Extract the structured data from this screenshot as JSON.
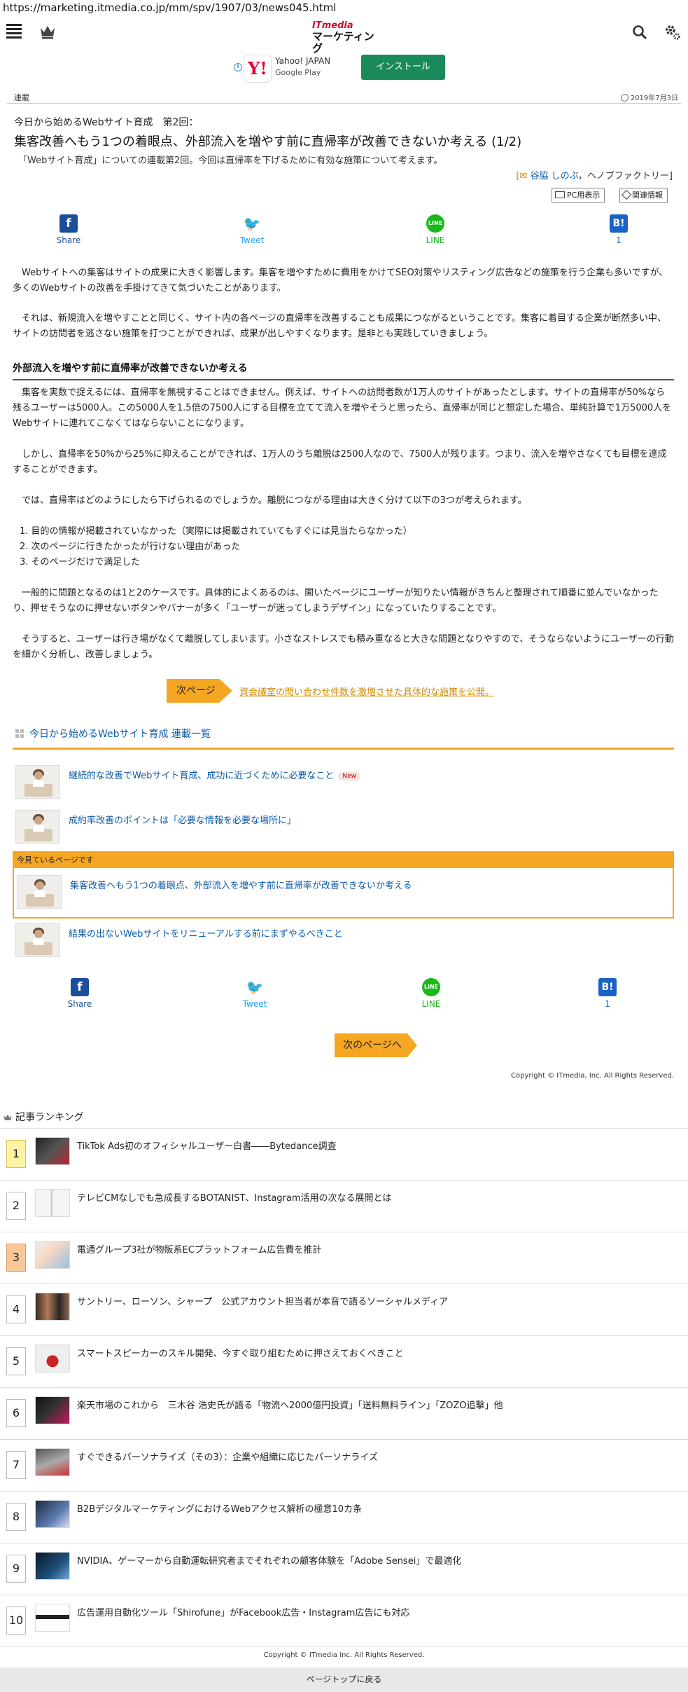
{
  "browser": {
    "url": "https://marketing.itmedia.co.jp/mm/spv/1907/03/news045.html"
  },
  "header": {
    "logo_top": "ITmedia",
    "logo_bottom": "マーケティング"
  },
  "ad": {
    "title": "Yahoo! JAPAN",
    "store": "Google Play",
    "install": "インストール",
    "icon_letter": "Y!"
  },
  "article": {
    "kind": "連載",
    "date": "2019年7月3日",
    "subtitle": "今日から始めるWebサイト育成　第2回：",
    "headline": "集客改善へもう1つの着眼点、外部流入を増やす前に直帰率が改善できないか考える (1/2)",
    "lead": "「Webサイト育成」についての連載第2回。今回は直帰率を下げるために有効な施策について考えます。",
    "byline_open": "[",
    "byline_author": "谷脇 しのぶ",
    "byline_org": "，ヘノブファクトリー]",
    "pc_display": "PC用表示",
    "related": "関連情報",
    "p1": "Webサイトへの集客はサイトの成果に大きく影響します。集客を増やすために費用をかけてSEO対策やリスティング広告などの施策を行う企業も多いですが、多くのWebサイトの改善を手掛けてきて気づいたことがあります。",
    "p2": "それは、新規流入を増やすことと同じく、サイト内の各ページの直帰率を改善することも成果につながるということです。集客に着目する企業が断然多い中、サイトの訪問者を逃さない施策を打つことができれば、成果が出しやすくなります。是非とも実践していきましょう。",
    "h2": "外部流入を増やす前に直帰率が改善できないか考える",
    "p3": "集客を実数で捉えるには、直帰率を無視することはできません。例えば、サイトへの訪問者数が1万人のサイトがあったとします。サイトの直帰率が50%なら残るユーザーは5000人。この5000人を1.5倍の7500人にする目標を立てて流入を増やそうと思ったら、直帰率が同じと想定した場合、単純計算で1万5000人をWebサイトに連れてこなくてはならないことになります。",
    "p4": "しかし、直帰率を50%から25%に抑えることができれば、1万人のうち離脱は2500人なので、7500人が残ります。つまり、流入を増やさなくても目標を達成することができます。",
    "p5": "では、直帰率はどのようにしたら下げられるのでしょうか。離脱につながる理由は大きく分けて以下の3つが考えられます。",
    "list": [
      "1. 目的の情報が掲載されていなかった（実際には掲載されていてもすぐには見当たらなかった）",
      "2. 次のページに行きたかったが行けない理由があった",
      "3. そのページだけで満足した"
    ],
    "p6": "一般的に問題となるのは1と2のケースです。具体的によくあるのは、開いたページにユーザーが知りたい情報がきちんと整理されて順番に並んでいなかったり、押せそうなのに押せないボタンやバナーが多く「ユーザーが迷ってしまうデザイン」になっていたりすることです。",
    "p7": "そうすると、ユーザーは行き場がなくて離脱してしまいます。小さなストレスでも積み重なると大きな問題となりやすので、そうならないようにユーザーの行動を細かく分析し、改善しましょう。",
    "next_tag": "次ページ",
    "next_link": "資会議室の問い合わせ件数を激増させた具体的な施策を公開。"
  },
  "share": {
    "facebook": "Share",
    "twitter": "Tweet",
    "line": "LINE",
    "hatena": "1",
    "fb_icon": "f",
    "hb_icon": "B!",
    "line_icon": "LINE",
    "tw_icon": "🐦"
  },
  "series": {
    "title": "今日から始めるWebサイト育成 連載一覧",
    "items": [
      {
        "title": "継続的な改善でWebサイト育成、成功に近づくために必要なこと",
        "badge": "New"
      },
      {
        "title": "成約率改善のポイントは「必要な情報を必要な場所に」"
      },
      {
        "title": "集客改善へもう1つの着眼点、外部流入を増やす前に直帰率が改善できないか考える"
      },
      {
        "title": "結果の出ないWebサイトをリニューアルする前にまずやるべきこと"
      }
    ],
    "current_label": "今見ているページです"
  },
  "next_button": "次のページへ",
  "copyright_article": "Copyright © ITmedia, Inc. All Rights Reserved.",
  "ranking": {
    "title": "記事ランキング",
    "items": [
      {
        "n": "1",
        "title": "TikTok Ads初のオフィシャルユーザー白書――Bytedance調査"
      },
      {
        "n": "2",
        "title": "テレビCMなしでも急成長するBOTANIST、Instagram活用の次なる展開とは"
      },
      {
        "n": "3",
        "title": "電通グループ3社が物販系ECプラットフォーム広告費を推計"
      },
      {
        "n": "4",
        "title": "サントリー、ローソン、シャープ　公式アカウント担当者が本音で語るソーシャルメディア"
      },
      {
        "n": "5",
        "title": "スマートスピーカーのスキル開発、今すぐ取り組むために押さえておくべきこと"
      },
      {
        "n": "6",
        "title": "楽天市場のこれから　三木谷 浩史氏が語る「物流へ2000億円投資」「送料無料ライン」「ZOZO追撃」他"
      },
      {
        "n": "7",
        "title": "すぐできるパーソナライズ（その3）：企業や組織に応じたパーソナライズ"
      },
      {
        "n": "8",
        "title": "B2BデジタルマーケティングにおけるWebアクセス解析の極意10カ条"
      },
      {
        "n": "9",
        "title": "NVIDIA、ゲーマーから自動運転研究者までそれぞれの顧客体験を「Adobe Sensei」で最適化"
      },
      {
        "n": "10",
        "title": "広告運用自動化ツール「Shirofune」がFacebook広告・Instagram広告にも対応"
      }
    ]
  },
  "copyright_footer": "Copyright © ITmedia Inc. All Rights Reserved.",
  "page_top": "ページトップに戻る"
}
